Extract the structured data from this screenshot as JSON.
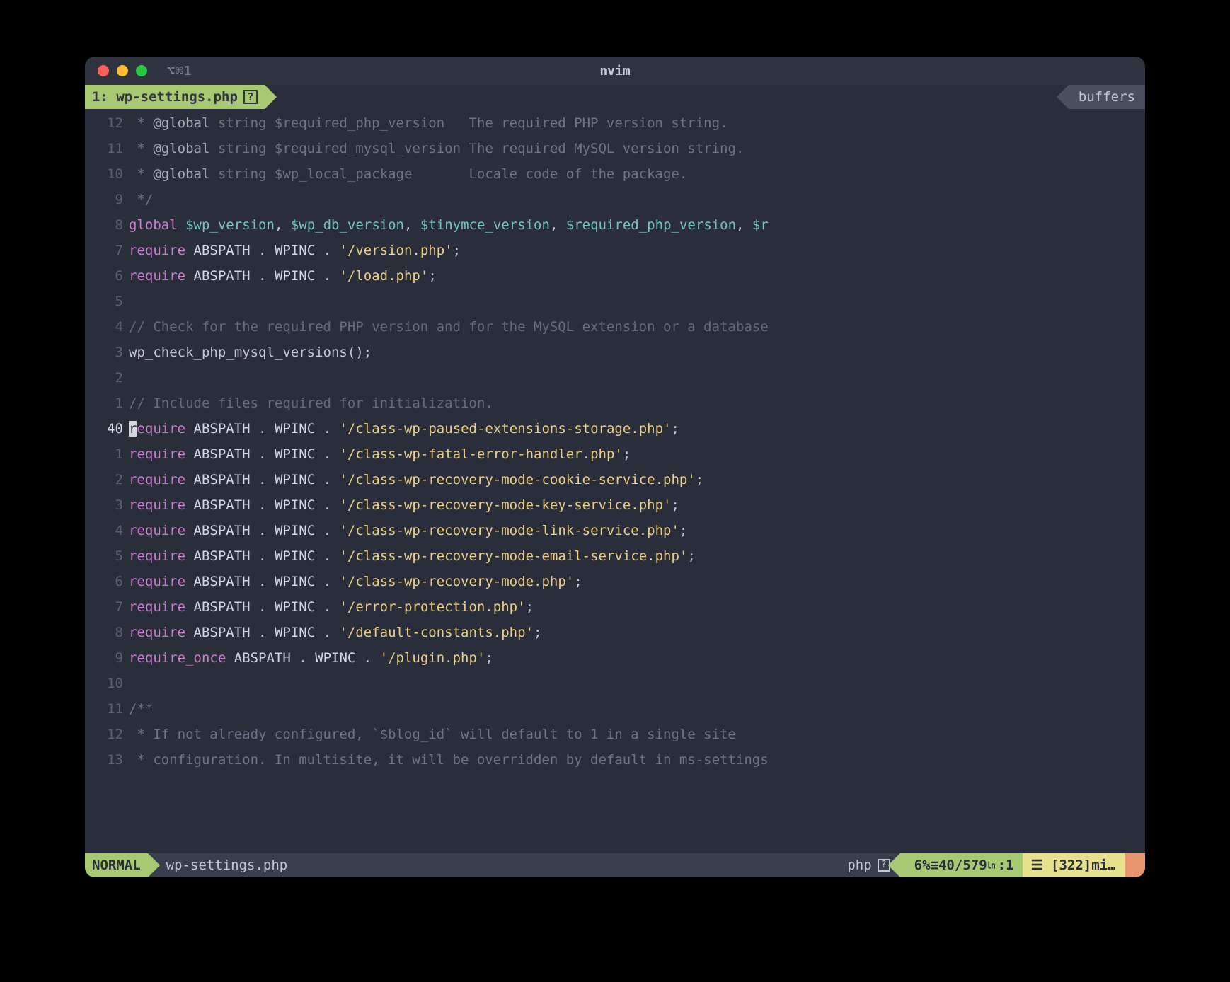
{
  "titlebar": {
    "hint": "⌥⌘1",
    "title": "nvim"
  },
  "tabline": {
    "active_index": "1:",
    "active_file": "wp-settings.php",
    "active_flag": "?",
    "right_label": "buffers"
  },
  "lines": [
    {
      "n": "12",
      "cur": false,
      "segs": [
        {
          "c": "doc",
          "t": " * "
        },
        {
          "c": "an",
          "t": "@global"
        },
        {
          "c": "doc",
          "t": " string $required_php_version   The required PHP version string."
        }
      ]
    },
    {
      "n": "11",
      "cur": false,
      "segs": [
        {
          "c": "doc",
          "t": " * "
        },
        {
          "c": "an",
          "t": "@global"
        },
        {
          "c": "doc",
          "t": " string $required_mysql_version The required MySQL version string."
        }
      ]
    },
    {
      "n": "10",
      "cur": false,
      "segs": [
        {
          "c": "doc",
          "t": " * "
        },
        {
          "c": "an",
          "t": "@global"
        },
        {
          "c": "doc",
          "t": " string $wp_local_package       Locale code of the package."
        }
      ]
    },
    {
      "n": "9",
      "cur": false,
      "segs": [
        {
          "c": "doc",
          "t": " */"
        }
      ]
    },
    {
      "n": "8",
      "cur": false,
      "segs": [
        {
          "c": "kw",
          "t": "global"
        },
        {
          "c": "p",
          "t": " "
        },
        {
          "c": "v",
          "t": "$wp_version"
        },
        {
          "c": "p",
          "t": ", "
        },
        {
          "c": "v",
          "t": "$wp_db_version"
        },
        {
          "c": "p",
          "t": ", "
        },
        {
          "c": "v",
          "t": "$tinymce_version"
        },
        {
          "c": "p",
          "t": ", "
        },
        {
          "c": "v",
          "t": "$required_php_version"
        },
        {
          "c": "p",
          "t": ", "
        },
        {
          "c": "v",
          "t": "$r"
        }
      ]
    },
    {
      "n": "7",
      "cur": false,
      "segs": [
        {
          "c": "kw",
          "t": "require"
        },
        {
          "c": "p",
          "t": " "
        },
        {
          "c": "c",
          "t": "ABSPATH"
        },
        {
          "c": "p",
          "t": " . "
        },
        {
          "c": "c",
          "t": "WPINC"
        },
        {
          "c": "p",
          "t": " . "
        },
        {
          "c": "s",
          "t": "'/version.php'"
        },
        {
          "c": "p",
          "t": ";"
        }
      ]
    },
    {
      "n": "6",
      "cur": false,
      "segs": [
        {
          "c": "kw",
          "t": "require"
        },
        {
          "c": "p",
          "t": " "
        },
        {
          "c": "c",
          "t": "ABSPATH"
        },
        {
          "c": "p",
          "t": " . "
        },
        {
          "c": "c",
          "t": "WPINC"
        },
        {
          "c": "p",
          "t": " . "
        },
        {
          "c": "s",
          "t": "'/load.php'"
        },
        {
          "c": "p",
          "t": ";"
        }
      ]
    },
    {
      "n": "5",
      "cur": false,
      "segs": []
    },
    {
      "n": "4",
      "cur": false,
      "segs": [
        {
          "c": "cm",
          "t": "// Check for the required PHP version and for the MySQL extension or a database"
        }
      ]
    },
    {
      "n": "3",
      "cur": false,
      "segs": [
        {
          "c": "p",
          "t": "wp_check_php_mysql_versions();"
        }
      ]
    },
    {
      "n": "2",
      "cur": false,
      "segs": []
    },
    {
      "n": "1",
      "cur": false,
      "segs": [
        {
          "c": "cm",
          "t": "// Include files required for initialization."
        }
      ]
    },
    {
      "n": "40",
      "cur": true,
      "segs": [
        {
          "c": "cursor",
          "t": "r"
        },
        {
          "c": "kw",
          "t": "equire"
        },
        {
          "c": "p",
          "t": " "
        },
        {
          "c": "c",
          "t": "ABSPATH"
        },
        {
          "c": "p",
          "t": " . "
        },
        {
          "c": "c",
          "t": "WPINC"
        },
        {
          "c": "p",
          "t": " . "
        },
        {
          "c": "s",
          "t": "'/class-wp-paused-extensions-storage.php'"
        },
        {
          "c": "p",
          "t": ";"
        }
      ]
    },
    {
      "n": "1",
      "cur": false,
      "segs": [
        {
          "c": "kw",
          "t": "require"
        },
        {
          "c": "p",
          "t": " "
        },
        {
          "c": "c",
          "t": "ABSPATH"
        },
        {
          "c": "p",
          "t": " . "
        },
        {
          "c": "c",
          "t": "WPINC"
        },
        {
          "c": "p",
          "t": " . "
        },
        {
          "c": "s",
          "t": "'/class-wp-fatal-error-handler.php'"
        },
        {
          "c": "p",
          "t": ";"
        }
      ]
    },
    {
      "n": "2",
      "cur": false,
      "segs": [
        {
          "c": "kw",
          "t": "require"
        },
        {
          "c": "p",
          "t": " "
        },
        {
          "c": "c",
          "t": "ABSPATH"
        },
        {
          "c": "p",
          "t": " . "
        },
        {
          "c": "c",
          "t": "WPINC"
        },
        {
          "c": "p",
          "t": " . "
        },
        {
          "c": "s",
          "t": "'/class-wp-recovery-mode-cookie-service.php'"
        },
        {
          "c": "p",
          "t": ";"
        }
      ]
    },
    {
      "n": "3",
      "cur": false,
      "segs": [
        {
          "c": "kw",
          "t": "require"
        },
        {
          "c": "p",
          "t": " "
        },
        {
          "c": "c",
          "t": "ABSPATH"
        },
        {
          "c": "p",
          "t": " . "
        },
        {
          "c": "c",
          "t": "WPINC"
        },
        {
          "c": "p",
          "t": " . "
        },
        {
          "c": "s",
          "t": "'/class-wp-recovery-mode-key-service.php'"
        },
        {
          "c": "p",
          "t": ";"
        }
      ]
    },
    {
      "n": "4",
      "cur": false,
      "segs": [
        {
          "c": "kw",
          "t": "require"
        },
        {
          "c": "p",
          "t": " "
        },
        {
          "c": "c",
          "t": "ABSPATH"
        },
        {
          "c": "p",
          "t": " . "
        },
        {
          "c": "c",
          "t": "WPINC"
        },
        {
          "c": "p",
          "t": " . "
        },
        {
          "c": "s",
          "t": "'/class-wp-recovery-mode-link-service.php'"
        },
        {
          "c": "p",
          "t": ";"
        }
      ]
    },
    {
      "n": "5",
      "cur": false,
      "segs": [
        {
          "c": "kw",
          "t": "require"
        },
        {
          "c": "p",
          "t": " "
        },
        {
          "c": "c",
          "t": "ABSPATH"
        },
        {
          "c": "p",
          "t": " . "
        },
        {
          "c": "c",
          "t": "WPINC"
        },
        {
          "c": "p",
          "t": " . "
        },
        {
          "c": "s",
          "t": "'/class-wp-recovery-mode-email-service.php'"
        },
        {
          "c": "p",
          "t": ";"
        }
      ]
    },
    {
      "n": "6",
      "cur": false,
      "segs": [
        {
          "c": "kw",
          "t": "require"
        },
        {
          "c": "p",
          "t": " "
        },
        {
          "c": "c",
          "t": "ABSPATH"
        },
        {
          "c": "p",
          "t": " . "
        },
        {
          "c": "c",
          "t": "WPINC"
        },
        {
          "c": "p",
          "t": " . "
        },
        {
          "c": "s",
          "t": "'/class-wp-recovery-mode.php'"
        },
        {
          "c": "p",
          "t": ";"
        }
      ]
    },
    {
      "n": "7",
      "cur": false,
      "segs": [
        {
          "c": "kw",
          "t": "require"
        },
        {
          "c": "p",
          "t": " "
        },
        {
          "c": "c",
          "t": "ABSPATH"
        },
        {
          "c": "p",
          "t": " . "
        },
        {
          "c": "c",
          "t": "WPINC"
        },
        {
          "c": "p",
          "t": " . "
        },
        {
          "c": "s",
          "t": "'/error-protection.php'"
        },
        {
          "c": "p",
          "t": ";"
        }
      ]
    },
    {
      "n": "8",
      "cur": false,
      "segs": [
        {
          "c": "kw",
          "t": "require"
        },
        {
          "c": "p",
          "t": " "
        },
        {
          "c": "c",
          "t": "ABSPATH"
        },
        {
          "c": "p",
          "t": " . "
        },
        {
          "c": "c",
          "t": "WPINC"
        },
        {
          "c": "p",
          "t": " . "
        },
        {
          "c": "s",
          "t": "'/default-constants.php'"
        },
        {
          "c": "p",
          "t": ";"
        }
      ]
    },
    {
      "n": "9",
      "cur": false,
      "segs": [
        {
          "c": "kw",
          "t": "require_once"
        },
        {
          "c": "p",
          "t": " "
        },
        {
          "c": "c",
          "t": "ABSPATH"
        },
        {
          "c": "p",
          "t": " . "
        },
        {
          "c": "c",
          "t": "WPINC"
        },
        {
          "c": "p",
          "t": " . "
        },
        {
          "c": "s",
          "t": "'/plugin.php'"
        },
        {
          "c": "p",
          "t": ";"
        }
      ]
    },
    {
      "n": "10",
      "cur": false,
      "segs": []
    },
    {
      "n": "11",
      "cur": false,
      "segs": [
        {
          "c": "doc",
          "t": "/**"
        }
      ]
    },
    {
      "n": "12",
      "cur": false,
      "segs": [
        {
          "c": "doc",
          "t": " * If not already configured, `$blog_id` will default to 1 in a single site"
        }
      ]
    },
    {
      "n": "13",
      "cur": false,
      "segs": [
        {
          "c": "doc",
          "t": " * configuration. In multisite, it will be overridden by default in ms-settings"
        }
      ]
    }
  ],
  "status": {
    "mode": "NORMAL",
    "file": "wp-settings.php",
    "filetype": "php",
    "ft_flag": "?",
    "percent": "6%",
    "line_icon": "≡",
    "line": "40",
    "total": "579",
    "col_icon": "㏑",
    "col": ":1",
    "yellow": "☰ [322]mi…"
  }
}
